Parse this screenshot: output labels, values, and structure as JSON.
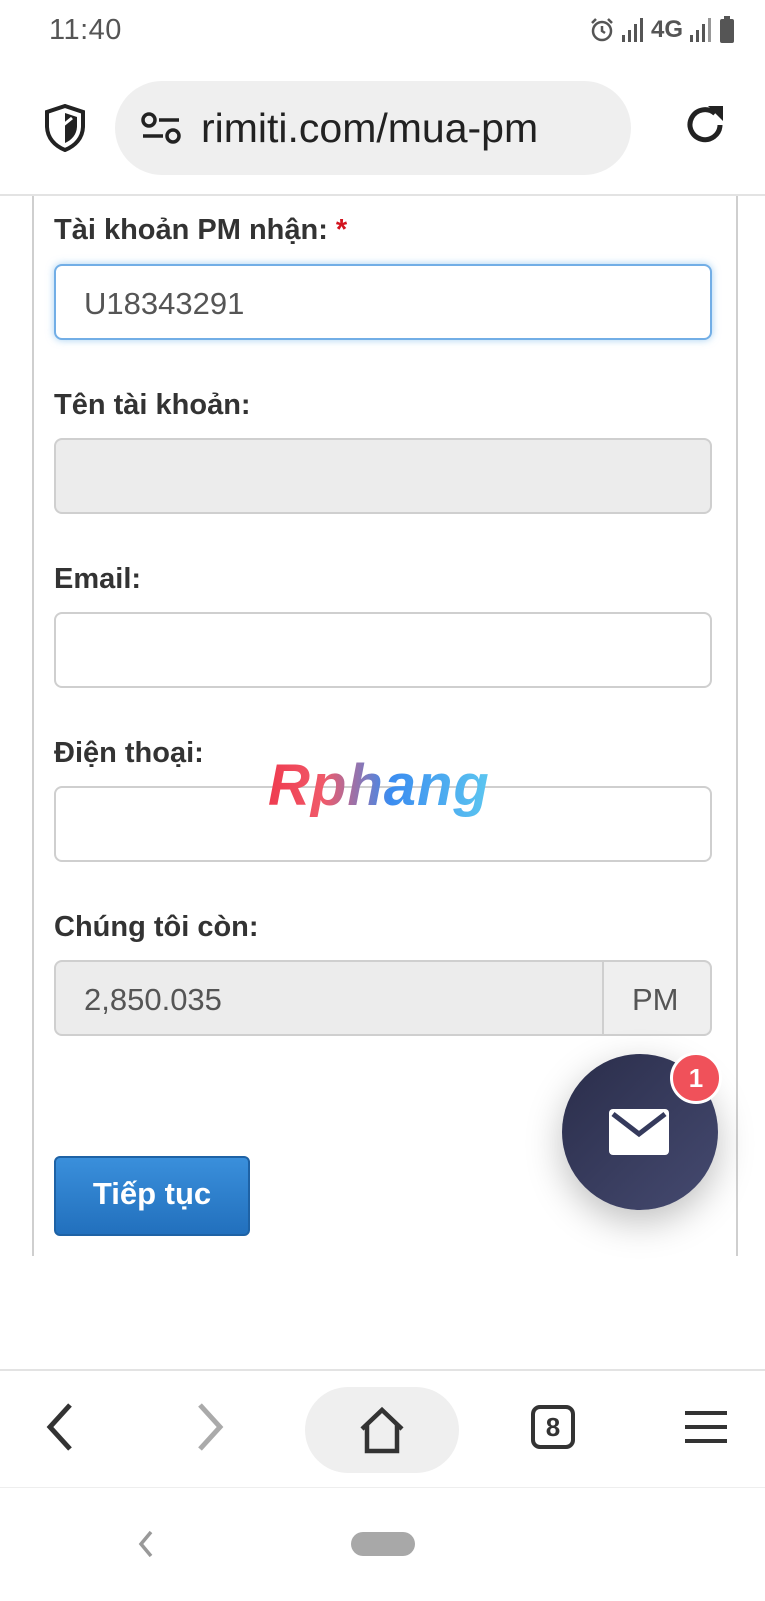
{
  "status_bar": {
    "time": "11:40",
    "network": "4G"
  },
  "browser": {
    "url": "rimiti.com/mua-pm"
  },
  "form": {
    "account_label": "Tài khoản PM nhận:",
    "required_mark": "*",
    "account_value": "U18343291",
    "name_label": "Tên tài khoản:",
    "email_label": "Email:",
    "phone_label": "Điện thoại:",
    "remaining_label": "Chúng tôi còn:",
    "remaining_value": "2,850.035",
    "remaining_unit": "PM",
    "submit_label": "Tiếp tục"
  },
  "watermark": {
    "text": "Rphang"
  },
  "chat": {
    "badge_count": "1"
  },
  "bottom_nav": {
    "tab_count": "8"
  }
}
